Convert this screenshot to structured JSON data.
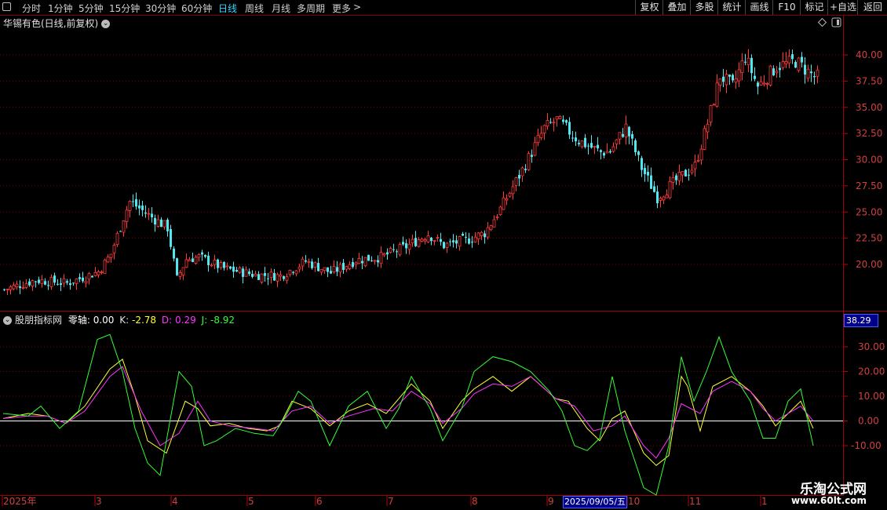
{
  "toolbar": {
    "icon": "square-icon",
    "periods": [
      "分时",
      "1分钟",
      "5分钟",
      "15分钟",
      "30分钟",
      "60分钟",
      "日线",
      "周线",
      "月线",
      "多周期",
      "更多"
    ],
    "active_period": "日线",
    "more_arrow": ">",
    "right_buttons": [
      "复权",
      "叠加",
      "多股",
      "统计",
      "画线",
      "F10",
      "标记",
      "+自选",
      "返回"
    ]
  },
  "stock": {
    "title": "华锡有色(日线,前复权)",
    "price_axis": [
      "40.00",
      "37.50",
      "35.00",
      "32.50",
      "30.00",
      "27.50",
      "25.00",
      "22.50",
      "20.00"
    ]
  },
  "indicator": {
    "name": "股朋指标网",
    "zero_label": "零轴:",
    "zero_value": "0.00",
    "k_label": "K:",
    "k_value": "-2.78",
    "d_label": "D:",
    "d_value": "0.29",
    "j_label": "J:",
    "j_value": "-8.92",
    "axis": [
      "30.00",
      "20.00",
      "10.00",
      "0.00",
      "-10.00"
    ],
    "cursor_value": "38.29"
  },
  "date_axis": {
    "labels": [
      "2025年",
      "3",
      "4",
      "5",
      "6",
      "7",
      "8",
      "9",
      "10",
      "11",
      "1"
    ],
    "cursor_date": "2025/09/05/五"
  },
  "watermark": {
    "line1": "乐淘公式网",
    "line2": "www.60lt.com"
  },
  "colors": {
    "up": "#ff3b3b",
    "down": "#4fe8f0",
    "k_line": "#ffff33",
    "d_line": "#ff33ff",
    "j_line": "#33ff33",
    "grid": "#800000",
    "active": "#33d6ff"
  },
  "chart_data": [
    {
      "type": "candlestick",
      "title": "华锡有色(日线,前复权)",
      "y_ticks": [
        20.0,
        22.5,
        25.0,
        27.5,
        30.0,
        32.5,
        35.0,
        37.5,
        40.0
      ],
      "x_ticks": [
        "2025年",
        "3",
        "4",
        "5",
        "6",
        "7",
        "8",
        "9",
        "10",
        "11",
        "1"
      ],
      "close_approx": [
        [
          0,
          17.6
        ],
        [
          10,
          18.5
        ],
        [
          20,
          18.2
        ],
        [
          30,
          19.3
        ],
        [
          34,
          21.0
        ],
        [
          38,
          24.5
        ],
        [
          40,
          26.0
        ],
        [
          46,
          24.7
        ],
        [
          52,
          23.5
        ],
        [
          55,
          18.6
        ],
        [
          58,
          20.5
        ],
        [
          62,
          20.7
        ],
        [
          70,
          19.6
        ],
        [
          80,
          19.0
        ],
        [
          88,
          18.9
        ],
        [
          96,
          20.3
        ],
        [
          104,
          19.2
        ],
        [
          112,
          20.4
        ],
        [
          120,
          20.7
        ],
        [
          128,
          21.7
        ],
        [
          135,
          22.9
        ],
        [
          140,
          21.8
        ],
        [
          148,
          22.4
        ],
        [
          153,
          23.0
        ],
        [
          158,
          25.3
        ],
        [
          165,
          29.0
        ],
        [
          172,
          33.0
        ],
        [
          176,
          33.8
        ],
        [
          183,
          31.8
        ],
        [
          190,
          30.7
        ],
        [
          193,
          30.8
        ],
        [
          198,
          33.1
        ],
        [
          203,
          29.2
        ],
        [
          208,
          26.4
        ],
        [
          214,
          28.0
        ],
        [
          220,
          29.4
        ],
        [
          224,
          33.5
        ],
        [
          228,
          38.0
        ],
        [
          232,
          37.0
        ],
        [
          236,
          39.8
        ],
        [
          240,
          37.0
        ],
        [
          246,
          38.9
        ],
        [
          252,
          39.4
        ],
        [
          258,
          37.9
        ]
      ]
    },
    {
      "type": "line",
      "series": [
        {
          "name": "K",
          "values": [
            [
              0,
              1
            ],
            [
              8,
              3
            ],
            [
              14,
              2
            ],
            [
              20,
              -1
            ],
            [
              26,
              6
            ],
            [
              34,
              21
            ],
            [
              38,
              25
            ],
            [
              42,
              10
            ],
            [
              46,
              -8
            ],
            [
              52,
              -13
            ],
            [
              58,
              8
            ],
            [
              62,
              5
            ],
            [
              66,
              -2
            ],
            [
              72,
              -1
            ],
            [
              78,
              -3
            ],
            [
              84,
              -4
            ],
            [
              88,
              -2
            ],
            [
              92,
              8
            ],
            [
              98,
              5
            ],
            [
              104,
              -2
            ],
            [
              110,
              4
            ],
            [
              116,
              7
            ],
            [
              122,
              3
            ],
            [
              130,
              15
            ],
            [
              136,
              8
            ],
            [
              140,
              -3
            ],
            [
              146,
              8
            ],
            [
              150,
              13
            ],
            [
              156,
              18
            ],
            [
              162,
              12
            ],
            [
              168,
              18
            ],
            [
              176,
              9
            ],
            [
              180,
              8
            ],
            [
              186,
              -3
            ],
            [
              190,
              -8
            ],
            [
              194,
              1
            ],
            [
              198,
              4
            ],
            [
              204,
              -13
            ],
            [
              208,
              -18
            ],
            [
              212,
              -14
            ],
            [
              216,
              18
            ],
            [
              218,
              14
            ],
            [
              222,
              -4
            ],
            [
              226,
              14
            ],
            [
              232,
              18
            ],
            [
              238,
              12
            ],
            [
              242,
              6
            ],
            [
              246,
              -2
            ],
            [
              250,
              3
            ],
            [
              254,
              8
            ],
            [
              258,
              -3
            ]
          ]
        },
        {
          "name": "D",
          "values": [
            [
              0,
              1
            ],
            [
              8,
              2
            ],
            [
              14,
              2
            ],
            [
              20,
              -1
            ],
            [
              26,
              4
            ],
            [
              34,
              18
            ],
            [
              38,
              22
            ],
            [
              44,
              4
            ],
            [
              50,
              -10
            ],
            [
              56,
              -5
            ],
            [
              62,
              8
            ],
            [
              66,
              0
            ],
            [
              72,
              -2
            ],
            [
              80,
              -3
            ],
            [
              86,
              -4
            ],
            [
              92,
              4
            ],
            [
              98,
              6
            ],
            [
              104,
              -1
            ],
            [
              110,
              2
            ],
            [
              118,
              5
            ],
            [
              124,
              4
            ],
            [
              130,
              12
            ],
            [
              136,
              7
            ],
            [
              140,
              -1
            ],
            [
              146,
              5
            ],
            [
              150,
              11
            ],
            [
              156,
              15
            ],
            [
              162,
              14
            ],
            [
              168,
              18
            ],
            [
              176,
              9
            ],
            [
              182,
              6
            ],
            [
              188,
              -4
            ],
            [
              194,
              -2
            ],
            [
              198,
              2
            ],
            [
              204,
              -10
            ],
            [
              208,
              -15
            ],
            [
              212,
              -7
            ],
            [
              216,
              7
            ],
            [
              222,
              3
            ],
            [
              226,
              12
            ],
            [
              232,
              16
            ],
            [
              238,
              12
            ],
            [
              242,
              5
            ],
            [
              246,
              0
            ],
            [
              250,
              3
            ],
            [
              254,
              6
            ],
            [
              258,
              0
            ]
          ]
        },
        {
          "name": "J",
          "values": [
            [
              0,
              3
            ],
            [
              8,
              2
            ],
            [
              12,
              6
            ],
            [
              18,
              -3
            ],
            [
              24,
              4
            ],
            [
              30,
              33
            ],
            [
              34,
              35
            ],
            [
              38,
              20
            ],
            [
              42,
              -3
            ],
            [
              46,
              -17
            ],
            [
              50,
              -22
            ],
            [
              56,
              20
            ],
            [
              60,
              14
            ],
            [
              64,
              -10
            ],
            [
              68,
              -8
            ],
            [
              74,
              -3
            ],
            [
              80,
              -5
            ],
            [
              86,
              -6
            ],
            [
              90,
              2
            ],
            [
              94,
              12
            ],
            [
              98,
              8
            ],
            [
              104,
              -10
            ],
            [
              110,
              6
            ],
            [
              116,
              12
            ],
            [
              122,
              -3
            ],
            [
              126,
              5
            ],
            [
              130,
              18
            ],
            [
              136,
              5
            ],
            [
              140,
              -8
            ],
            [
              146,
              5
            ],
            [
              150,
              20
            ],
            [
              156,
              26
            ],
            [
              162,
              24
            ],
            [
              168,
              20
            ],
            [
              174,
              12
            ],
            [
              178,
              4
            ],
            [
              182,
              -10
            ],
            [
              186,
              -12
            ],
            [
              190,
              -7
            ],
            [
              194,
              18
            ],
            [
              198,
              -4
            ],
            [
              204,
              -27
            ],
            [
              208,
              -30
            ],
            [
              212,
              -10
            ],
            [
              216,
              26
            ],
            [
              220,
              8
            ],
            [
              224,
              20
            ],
            [
              228,
              34
            ],
            [
              232,
              20
            ],
            [
              238,
              8
            ],
            [
              242,
              -7
            ],
            [
              246,
              -7
            ],
            [
              250,
              8
            ],
            [
              254,
              13
            ],
            [
              258,
              -10
            ]
          ]
        }
      ],
      "ylim": [
        -10,
        30
      ]
    }
  ]
}
